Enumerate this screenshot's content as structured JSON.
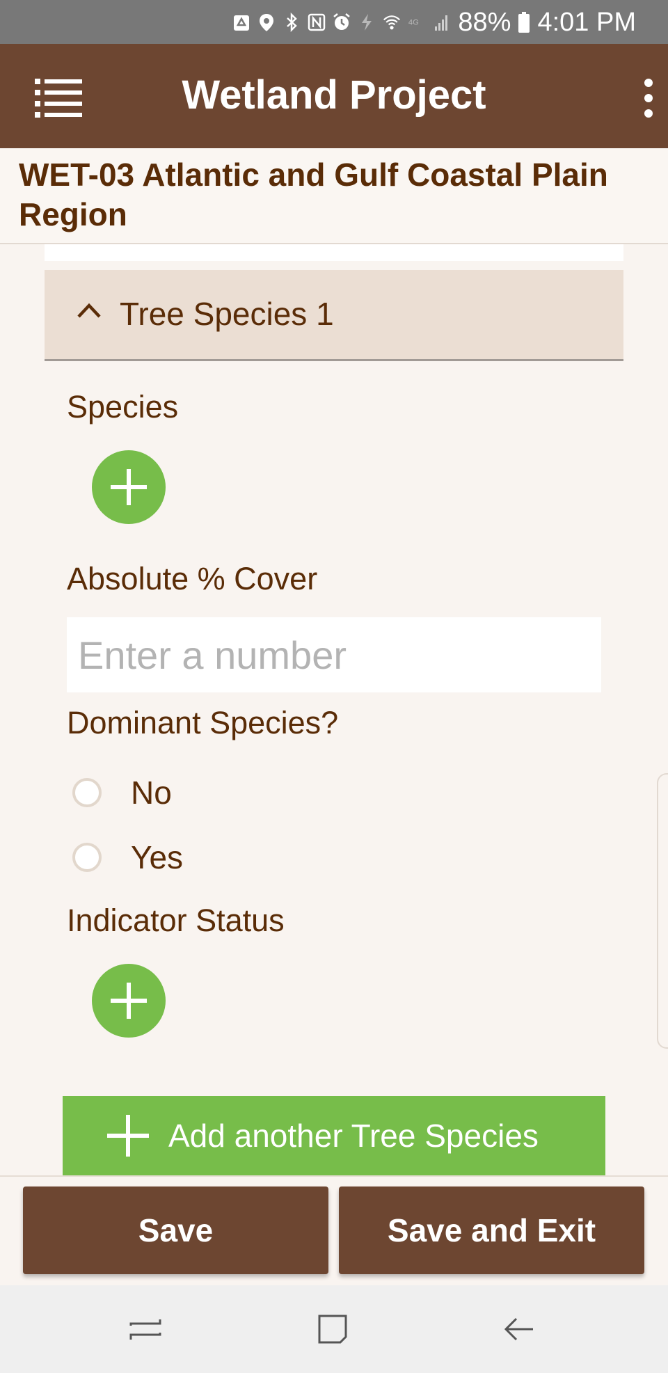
{
  "status_bar": {
    "battery": "88%",
    "time": "4:01 PM",
    "icons": [
      "recycle-icon",
      "location-pin-icon",
      "bluetooth-icon",
      "nfc-icon",
      "alarm-icon",
      "data-saver-icon",
      "wifi-icon",
      "lte-icon",
      "signal-icon",
      "battery-icon"
    ]
  },
  "app_bar": {
    "title": "Wetland Project",
    "menu_icon": "list-menu-icon",
    "overflow_icon": "more-vert-icon"
  },
  "form": {
    "title": "WET-03 Atlantic and Gulf Coastal Plain Region"
  },
  "section": {
    "title": "Tree Species 1",
    "species_label": "Species",
    "cover_label": "Absolute % Cover",
    "cover_placeholder": "Enter a number",
    "cover_value": "",
    "dominant_label": "Dominant Species?",
    "dominant_options": [
      "No",
      "Yes"
    ],
    "indicator_label": "Indicator Status",
    "add_another_label": "Add another Tree Species"
  },
  "footer": {
    "save_label": "Save",
    "save_exit_label": "Save and Exit"
  },
  "colors": {
    "brown": "#6d4631",
    "text_brown": "#5a2c07",
    "green": "#77bd4a",
    "background": "#f9f4f0",
    "section_header": "#ebded3"
  }
}
